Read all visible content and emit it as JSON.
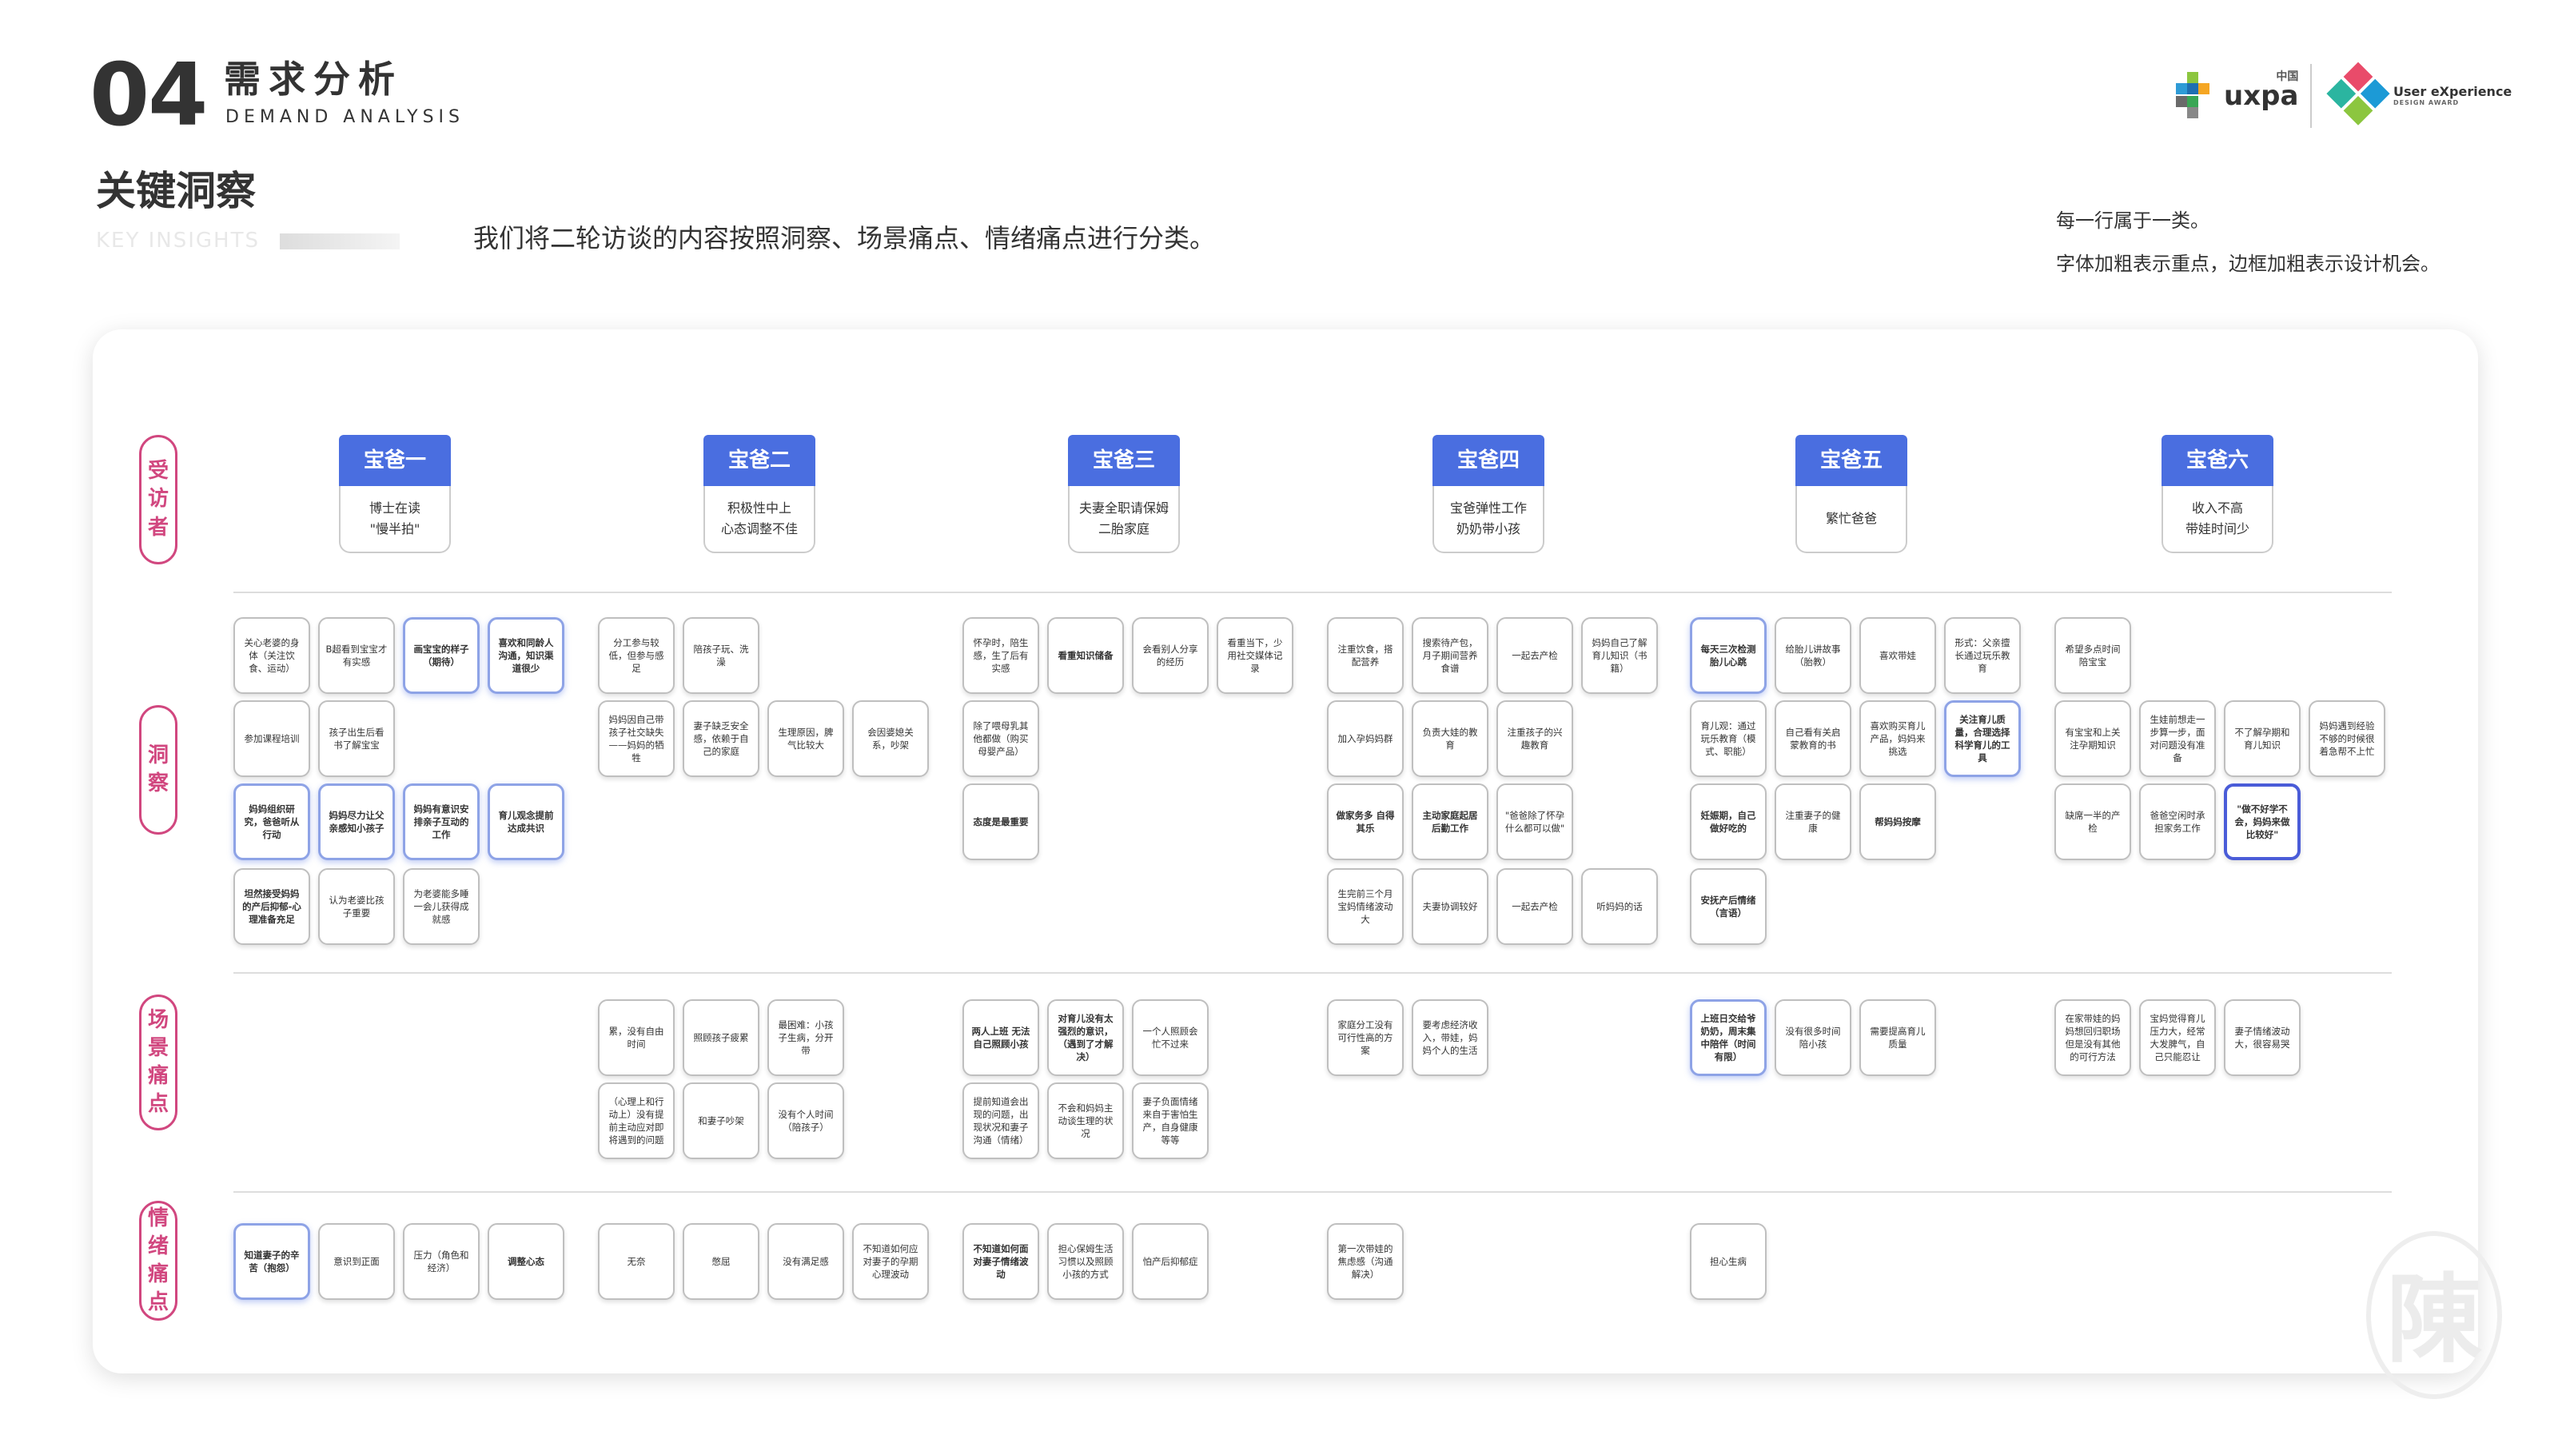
{
  "header": {
    "num": "04",
    "title_cn": "需求分析",
    "title_en": "DEMAND ANALYSIS",
    "logo1": "uxpa",
    "logo1_small": "中国",
    "logo2_line1": "User eXperience",
    "logo2_line2": "DESIGN AWARD"
  },
  "section": {
    "title": "关键洞察",
    "subtitle": "KEY INSIGHTS",
    "intro": "我们将二轮访谈的内容按照洞察、场景痛点、情绪痛点进行分类。"
  },
  "notes": [
    "每一行属于一类。",
    "字体加粗表示重点，边框加粗表示设计机会。"
  ],
  "categories": [
    "受访者",
    "洞察",
    "场景痛点",
    "情绪痛点"
  ],
  "interviewees": [
    {
      "name": "宝爸一",
      "desc": "博士在读\n\"慢半拍\""
    },
    {
      "name": "宝爸二",
      "desc": "积极性中上\n心态调整不佳"
    },
    {
      "name": "宝爸三",
      "desc": "夫妻全职请保姆\n二胎家庭"
    },
    {
      "name": "宝爸四",
      "desc": "宝爸弹性工作\n奶奶带小孩"
    },
    {
      "name": "宝爸五",
      "desc": "繁忙爸爸"
    },
    {
      "name": "宝爸六",
      "desc": "收入不高\n带娃时间少"
    }
  ],
  "stickies": [
    {
      "c": 0,
      "r": 0,
      "col": 0,
      "t": "关心老婆的身体（关注饮食、运动）",
      "s": "n"
    },
    {
      "c": 0,
      "r": 0,
      "col": 1,
      "t": "B超看到宝宝才有实感",
      "s": "n"
    },
    {
      "c": 0,
      "r": 0,
      "col": 2,
      "t": "画宝宝的样子（期待）",
      "s": "bk"
    },
    {
      "c": 0,
      "r": 0,
      "col": 3,
      "t": "喜欢和同龄人沟通，知识渠道很少",
      "s": "bk"
    },
    {
      "c": 0,
      "r": 1,
      "col": 0,
      "t": "参加课程培训",
      "s": "n"
    },
    {
      "c": 0,
      "r": 1,
      "col": 1,
      "t": "孩子出生后看书了解宝宝",
      "s": "n"
    },
    {
      "c": 0,
      "r": 2,
      "col": 0,
      "t": "妈妈组织研究，爸爸听从行动",
      "s": "bk"
    },
    {
      "c": 0,
      "r": 2,
      "col": 1,
      "t": "妈妈尽力让父亲感知小孩子",
      "s": "bk"
    },
    {
      "c": 0,
      "r": 2,
      "col": 2,
      "t": "妈妈有意识安排亲子互动的工作",
      "s": "bk"
    },
    {
      "c": 0,
      "r": 2,
      "col": 3,
      "t": "育儿观念提前达成共识",
      "s": "bk"
    },
    {
      "c": 0,
      "r": 3,
      "col": 0,
      "t": "坦然接受妈妈的产后抑郁-心理准备充足",
      "s": "b"
    },
    {
      "c": 0,
      "r": 3,
      "col": 1,
      "t": "认为老婆比孩子重要",
      "s": "n"
    },
    {
      "c": 0,
      "r": 3,
      "col": 2,
      "t": "为老婆能多睡一会儿获得成就感",
      "s": "n"
    },
    {
      "c": 1,
      "r": 0,
      "col": 0,
      "t": "分工参与较低，但参与感足",
      "s": "n"
    },
    {
      "c": 1,
      "r": 0,
      "col": 1,
      "t": "陪孩子玩、洗澡",
      "s": "n"
    },
    {
      "c": 1,
      "r": 1,
      "col": 0,
      "t": "妈妈因自己带孩子社交缺失——妈妈的牺牲",
      "s": "n"
    },
    {
      "c": 1,
      "r": 1,
      "col": 1,
      "t": "妻子缺乏安全感，依赖于自己的家庭",
      "s": "n"
    },
    {
      "c": 1,
      "r": 1,
      "col": 2,
      "t": "生理原因，脾气比较大",
      "s": "n"
    },
    {
      "c": 1,
      "r": 1,
      "col": 3,
      "t": "会因婆媳关系，吵架",
      "s": "n"
    },
    {
      "c": 2,
      "r": 0,
      "col": 0,
      "t": "怀孕时，陪生感，生了后有实感",
      "s": "n"
    },
    {
      "c": 2,
      "r": 0,
      "col": 1,
      "t": "看重知识储备",
      "s": "b"
    },
    {
      "c": 2,
      "r": 0,
      "col": 2,
      "t": "会看别人分享的经历",
      "s": "n"
    },
    {
      "c": 2,
      "r": 0,
      "col": 3,
      "t": "看重当下，少用社交媒体记录",
      "s": "n"
    },
    {
      "c": 2,
      "r": 1,
      "col": 0,
      "t": "除了喂母乳其他都做（购买母婴产品）",
      "s": "n"
    },
    {
      "c": 2,
      "r": 2,
      "col": 0,
      "t": "态度是最重要",
      "s": "b"
    },
    {
      "c": 3,
      "r": 0,
      "col": 0,
      "t": "注重饮食，搭配营养",
      "s": "n"
    },
    {
      "c": 3,
      "r": 0,
      "col": 1,
      "t": "搜索待产包，月子期间营养食谱",
      "s": "n"
    },
    {
      "c": 3,
      "r": 0,
      "col": 2,
      "t": "一起去产检",
      "s": "n"
    },
    {
      "c": 3,
      "r": 0,
      "col": 3,
      "t": "妈妈自己了解育儿知识（书籍）",
      "s": "n"
    },
    {
      "c": 3,
      "r": 1,
      "col": 0,
      "t": "加入孕妈妈群",
      "s": "n"
    },
    {
      "c": 3,
      "r": 1,
      "col": 1,
      "t": "负责大娃的教育",
      "s": "n"
    },
    {
      "c": 3,
      "r": 1,
      "col": 2,
      "t": "注重孩子的兴趣教育",
      "s": "n"
    },
    {
      "c": 3,
      "r": 2,
      "col": 0,
      "t": "做家务多 自得其乐",
      "s": "b"
    },
    {
      "c": 3,
      "r": 2,
      "col": 1,
      "t": "主动家庭起居后勤工作",
      "s": "b"
    },
    {
      "c": 3,
      "r": 2,
      "col": 2,
      "t": "\"爸爸除了怀孕什么都可以做\"",
      "s": "n"
    },
    {
      "c": 3,
      "r": 3,
      "col": 0,
      "t": "生完前三个月宝妈情绪波动大",
      "s": "n"
    },
    {
      "c": 3,
      "r": 3,
      "col": 1,
      "t": "夫妻协调较好",
      "s": "n"
    },
    {
      "c": 3,
      "r": 3,
      "col": 2,
      "t": "一起去产检",
      "s": "n"
    },
    {
      "c": 3,
      "r": 3,
      "col": 3,
      "t": "听妈妈的话",
      "s": "n"
    },
    {
      "c": 4,
      "r": 0,
      "col": 0,
      "t": "每天三次检测胎儿心跳",
      "s": "bk"
    },
    {
      "c": 4,
      "r": 0,
      "col": 1,
      "t": "给胎儿讲故事（胎教）",
      "s": "n"
    },
    {
      "c": 4,
      "r": 0,
      "col": 2,
      "t": "喜欢带娃",
      "s": "n"
    },
    {
      "c": 4,
      "r": 0,
      "col": 3,
      "t": "形式：父亲擅长通过玩乐教育",
      "s": "n"
    },
    {
      "c": 4,
      "r": 1,
      "col": 0,
      "t": "育儿观：通过玩乐教育（模式、职能）",
      "s": "n"
    },
    {
      "c": 4,
      "r": 1,
      "col": 1,
      "t": "自己看有关启蒙教育的书",
      "s": "n"
    },
    {
      "c": 4,
      "r": 1,
      "col": 2,
      "t": "喜欢购买育儿产品，妈妈来挑选",
      "s": "n"
    },
    {
      "c": 4,
      "r": 1,
      "col": 3,
      "t": "关注育儿质量，合理选择科学育儿的工具",
      "s": "bk"
    },
    {
      "c": 4,
      "r": 2,
      "col": 0,
      "t": "妊娠期，自己做好吃的",
      "s": "b"
    },
    {
      "c": 4,
      "r": 2,
      "col": 1,
      "t": "注重妻子的健康",
      "s": "n"
    },
    {
      "c": 4,
      "r": 2,
      "col": 2,
      "t": "帮妈妈按摩",
      "s": "b"
    },
    {
      "c": 4,
      "r": 3,
      "col": 0,
      "t": "安抚产后情绪（言语）",
      "s": "b"
    },
    {
      "c": 5,
      "r": 0,
      "col": 0,
      "t": "希望多点时间陪宝宝",
      "s": "n"
    },
    {
      "c": 5,
      "r": 1,
      "col": 0,
      "t": "有宝宝和上关注孕期知识",
      "s": "n"
    },
    {
      "c": 5,
      "r": 1,
      "col": 1,
      "t": "生娃前想走一步算一步，面对问题没有准备",
      "s": "n"
    },
    {
      "c": 5,
      "r": 1,
      "col": 2,
      "t": "不了解孕期和育儿知识",
      "s": "n"
    },
    {
      "c": 5,
      "r": 1,
      "col": 3,
      "t": "妈妈遇到经验不够的时候很着急帮不上忙",
      "s": "n"
    },
    {
      "c": 5,
      "r": 2,
      "col": 0,
      "t": "缺席一半的产检",
      "s": "n"
    },
    {
      "c": 5,
      "r": 2,
      "col": 1,
      "t": "爸爸空闲时承担家务工作",
      "s": "n"
    },
    {
      "c": 5,
      "r": 2,
      "col": 2,
      "t": "\"做不好学不会，妈妈来做比较好\"",
      "s": "kk"
    }
  ],
  "pains": [
    {
      "c": 1,
      "r": 0,
      "col": 0,
      "t": "累，没有自由时间",
      "s": "n"
    },
    {
      "c": 1,
      "r": 0,
      "col": 1,
      "t": "照顾孩子疲累",
      "s": "n"
    },
    {
      "c": 1,
      "r": 0,
      "col": 2,
      "t": "最困难：小孩子生病，分开带",
      "s": "n"
    },
    {
      "c": 1,
      "r": 1,
      "col": 0,
      "t": "（心理上和行动上）没有提前主动应对即将遇到的问题",
      "s": "n"
    },
    {
      "c": 1,
      "r": 1,
      "col": 1,
      "t": "和妻子吵架",
      "s": "n"
    },
    {
      "c": 1,
      "r": 1,
      "col": 2,
      "t": "没有个人时间（陪孩子）",
      "s": "n"
    },
    {
      "c": 2,
      "r": 0,
      "col": 0,
      "t": "两人上班 无法自己照顾小孩",
      "s": "b"
    },
    {
      "c": 2,
      "r": 0,
      "col": 1,
      "t": "对育儿没有太强烈的意识，（遇到了才解决）",
      "s": "b"
    },
    {
      "c": 2,
      "r": 0,
      "col": 2,
      "t": "一个人照顾会忙不过来",
      "s": "n"
    },
    {
      "c": 2,
      "r": 1,
      "col": 0,
      "t": "提前知道会出现的问题，出现状况和妻子沟通（情绪）",
      "s": "n"
    },
    {
      "c": 2,
      "r": 1,
      "col": 1,
      "t": "不会和妈妈主动谈生理的状况",
      "s": "n"
    },
    {
      "c": 2,
      "r": 1,
      "col": 2,
      "t": "妻子负面情绪来自于害怕生产，自身健康等等",
      "s": "n"
    },
    {
      "c": 3,
      "r": 0,
      "col": 0,
      "t": "家庭分工没有可行性高的方案",
      "s": "n"
    },
    {
      "c": 3,
      "r": 0,
      "col": 1,
      "t": "要考虑经济收入，带娃，妈妈个人的生活",
      "s": "n"
    },
    {
      "c": 4,
      "r": 0,
      "col": 0,
      "t": "上班日交给爷奶奶，周末集中陪伴（时间有限）",
      "s": "bk"
    },
    {
      "c": 4,
      "r": 0,
      "col": 1,
      "t": "没有很多时间陪小孩",
      "s": "n"
    },
    {
      "c": 4,
      "r": 0,
      "col": 2,
      "t": "需要提高育儿质量",
      "s": "n"
    },
    {
      "c": 5,
      "r": 0,
      "col": 0,
      "t": "在家带娃的妈妈想回归职场但是没有其他的可行方法",
      "s": "n"
    },
    {
      "c": 5,
      "r": 0,
      "col": 1,
      "t": "宝妈觉得育儿压力大，经常大发脾气，自己只能忍让",
      "s": "n"
    },
    {
      "c": 5,
      "r": 0,
      "col": 2,
      "t": "妻子情绪波动大，很容易哭",
      "s": "n"
    }
  ],
  "emotions": [
    {
      "c": 0,
      "col": 0,
      "t": "知道妻子的辛苦（抱怨）",
      "s": "bk"
    },
    {
      "c": 0,
      "col": 1,
      "t": "意识到正面",
      "s": "n"
    },
    {
      "c": 0,
      "col": 2,
      "t": "压力（角色和经济）",
      "s": "n"
    },
    {
      "c": 0,
      "col": 3,
      "t": "调整心态",
      "s": "b"
    },
    {
      "c": 1,
      "col": 0,
      "t": "无奈",
      "s": "n"
    },
    {
      "c": 1,
      "col": 1,
      "t": "憋屈",
      "s": "n"
    },
    {
      "c": 1,
      "col": 2,
      "t": "没有满足感",
      "s": "n"
    },
    {
      "c": 1,
      "col": 3,
      "t": "不知道如何应对妻子的孕期心理波动",
      "s": "n"
    },
    {
      "c": 2,
      "col": 0,
      "t": "不知道如何面对妻子情绪波动",
      "s": "b"
    },
    {
      "c": 2,
      "col": 1,
      "t": "担心保姆生活习惯以及照顾小孩的方式",
      "s": "n"
    },
    {
      "c": 2,
      "col": 2,
      "t": "怕产后抑郁症",
      "s": "n"
    },
    {
      "c": 3,
      "col": 0,
      "t": "第一次带娃的焦虑感（沟通解决）",
      "s": "n"
    },
    {
      "c": 4,
      "col": 0,
      "t": "担心生病",
      "s": "n"
    }
  ],
  "colors": {
    "accent": "#4a6ee0",
    "category": "#d1477f",
    "key_border": "#8ea3e6",
    "opportunity_border": "#4a5cd8"
  }
}
